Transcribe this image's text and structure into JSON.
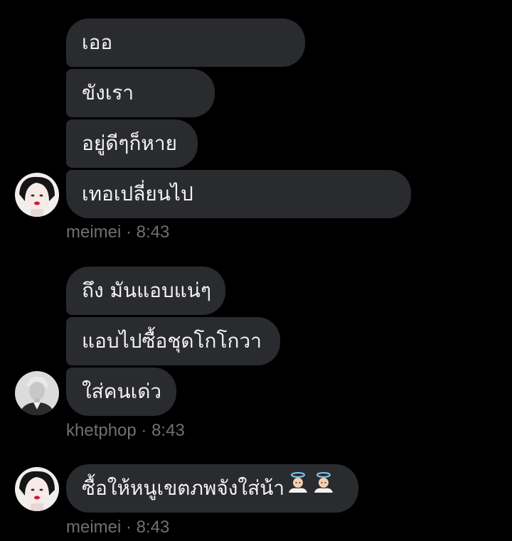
{
  "groups": [
    {
      "sender": "meimei",
      "time": "8:43",
      "meta": "meimei · 8:43",
      "messages": [
        "เออ",
        "ขังเรา",
        "อยู่ดีๆก็หาย",
        "เทอเปลี่ยนไป"
      ]
    },
    {
      "sender": "khetphop",
      "time": "8:43",
      "meta": "khetphop · 8:43",
      "messages": [
        "ถึง มันแอบแน่ๆ",
        "แอบไปซื้อชุดโกโกวา",
        "ใส่คนเด่ว"
      ]
    },
    {
      "sender": "meimei",
      "time": "8:43",
      "meta": "meimei · 8:43",
      "messages": [
        "ซื้อให้หนูเขตภพจังใส่น้า"
      ],
      "emoji": [
        "angel-emoji",
        "angel-emoji"
      ]
    }
  ]
}
